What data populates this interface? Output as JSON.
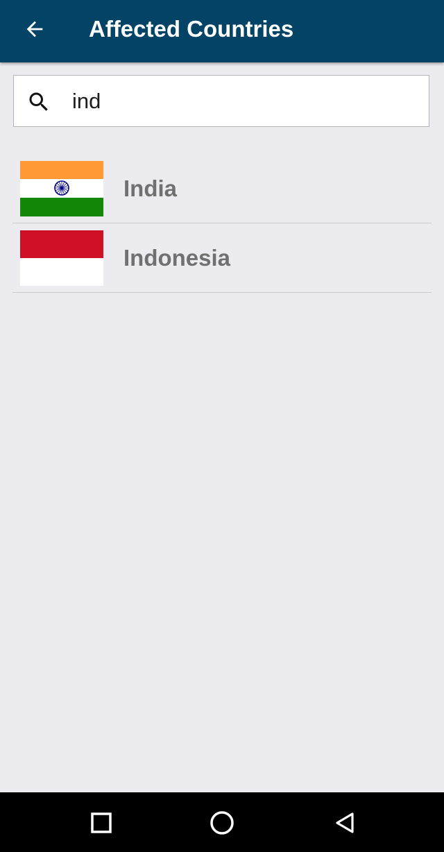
{
  "app_bar": {
    "title": "Affected Countries",
    "background": "#024366",
    "back_icon": "arrow-left-icon"
  },
  "search": {
    "value": "ind",
    "icon": "search-icon"
  },
  "countries": [
    {
      "name": "India",
      "flag": "india-flag",
      "flag_colors": [
        "#ff9933",
        "#ffffff",
        "#138808"
      ],
      "chakra_color": "#000080"
    },
    {
      "name": "Indonesia",
      "flag": "indonesia-flag",
      "flag_colors": [
        "#ce1126",
        "#ffffff"
      ]
    }
  ],
  "nav_bar": {
    "buttons": [
      "recents-square-icon",
      "home-circle-icon",
      "back-triangle-icon"
    ]
  }
}
